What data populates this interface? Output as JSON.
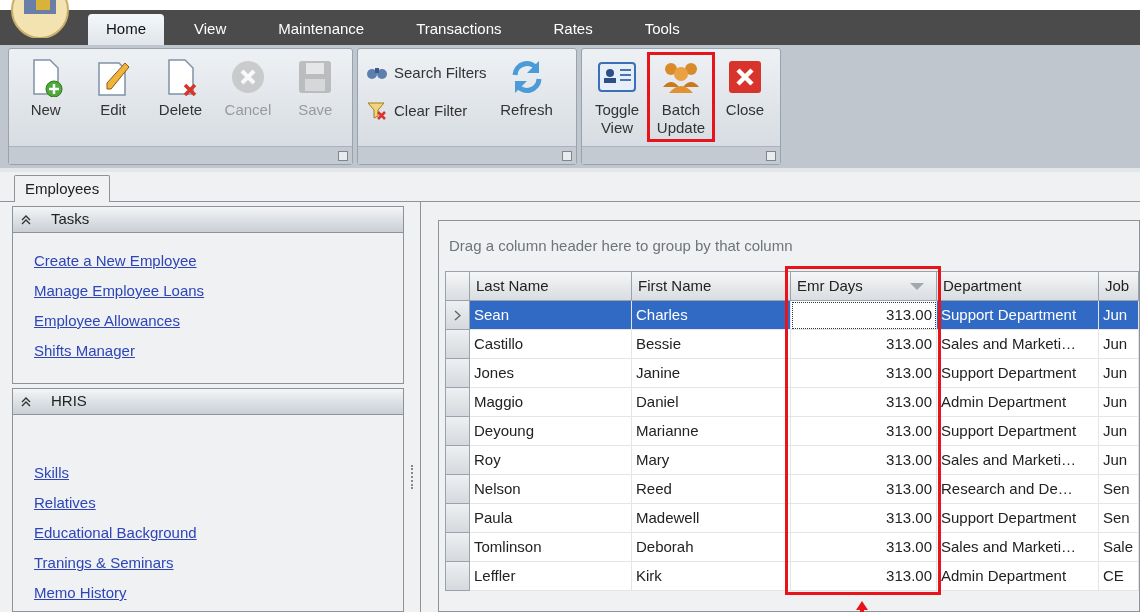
{
  "menu_tabs": [
    {
      "label": "Home",
      "selected": true
    },
    {
      "label": "View",
      "selected": false
    },
    {
      "label": "Maintenance",
      "selected": false
    },
    {
      "label": "Transactions",
      "selected": false
    },
    {
      "label": "Rates",
      "selected": false
    },
    {
      "label": "Tools",
      "selected": false
    }
  ],
  "ribbon_groups": [
    {
      "items": [
        {
          "kind": "large",
          "label": "New",
          "disabled": false,
          "highlighted": false
        },
        {
          "kind": "large",
          "label": "Edit",
          "disabled": false,
          "highlighted": false
        },
        {
          "kind": "large",
          "label": "Delete",
          "disabled": false,
          "highlighted": false
        },
        {
          "kind": "large",
          "label": "Cancel",
          "disabled": true,
          "highlighted": false
        },
        {
          "kind": "large",
          "label": "Save",
          "disabled": true,
          "highlighted": false
        }
      ]
    },
    {
      "items": [
        {
          "kind": "small",
          "label": "Search Filters",
          "disabled": false,
          "highlighted": false
        },
        {
          "kind": "small",
          "label": "Clear Filter",
          "disabled": false,
          "highlighted": false
        },
        {
          "kind": "large",
          "label": "Refresh",
          "disabled": false,
          "highlighted": false
        }
      ]
    },
    {
      "items": [
        {
          "kind": "large",
          "label": "Toggle View",
          "disabled": false,
          "highlighted": false
        },
        {
          "kind": "large",
          "label": "Batch Update",
          "disabled": false,
          "highlighted": true
        },
        {
          "kind": "large",
          "label": "Close",
          "disabled": false,
          "highlighted": false
        }
      ]
    }
  ],
  "document_tab": {
    "label": "Employees",
    "selected": true
  },
  "sidebar": [
    {
      "title": "Tasks",
      "expanded": true,
      "links": [
        "Create a New Employee",
        "Manage Employee Loans",
        "Employee Allowances",
        "Shifts Manager"
      ]
    },
    {
      "title": "HRIS",
      "expanded": true,
      "links": [
        "Skills",
        "Relatives",
        "Educational Background",
        "Tranings & Seminars",
        "Memo History"
      ]
    }
  ],
  "grid": {
    "group_hint": "Drag a column header here to group by that column",
    "columns": [
      {
        "label": "Last Name",
        "highlighted": false,
        "sorted": false
      },
      {
        "label": "First Name",
        "highlighted": false,
        "sorted": false
      },
      {
        "label": "Emr Days",
        "highlighted": true,
        "sorted": true
      },
      {
        "label": "Department",
        "highlighted": false,
        "sorted": false
      },
      {
        "label": "Job",
        "highlighted": false,
        "sorted": false
      }
    ],
    "rows": [
      {
        "selected": true,
        "cells": [
          "Sean",
          "Charles",
          "313.00",
          "Support Department",
          "Jun"
        ]
      },
      {
        "selected": false,
        "cells": [
          "Castillo",
          "Bessie",
          "313.00",
          "Sales and Marketi…",
          "Jun"
        ]
      },
      {
        "selected": false,
        "cells": [
          "Jones",
          "Janine",
          "313.00",
          "Support Department",
          "Jun"
        ]
      },
      {
        "selected": false,
        "cells": [
          "Maggio",
          "Daniel",
          "313.00",
          "Admin Department",
          "Jun"
        ]
      },
      {
        "selected": false,
        "cells": [
          "Deyoung",
          "Marianne",
          "313.00",
          "Support Department",
          "Jun"
        ]
      },
      {
        "selected": false,
        "cells": [
          "Roy",
          "Mary",
          "313.00",
          "Sales and Marketi…",
          "Jun"
        ]
      },
      {
        "selected": false,
        "cells": [
          "Nelson",
          "Reed",
          "313.00",
          "Research and De…",
          "Sen"
        ]
      },
      {
        "selected": false,
        "cells": [
          "Paula",
          "Madewell",
          "313.00",
          "Support Department",
          "Sen"
        ]
      },
      {
        "selected": false,
        "cells": [
          "Tomlinson",
          "Deborah",
          "313.00",
          "Sales and Marketi…",
          "Sale"
        ]
      },
      {
        "selected": false,
        "cells": [
          "Leffler",
          "Kirk",
          "313.00",
          "Admin Department",
          "CE"
        ]
      }
    ]
  }
}
